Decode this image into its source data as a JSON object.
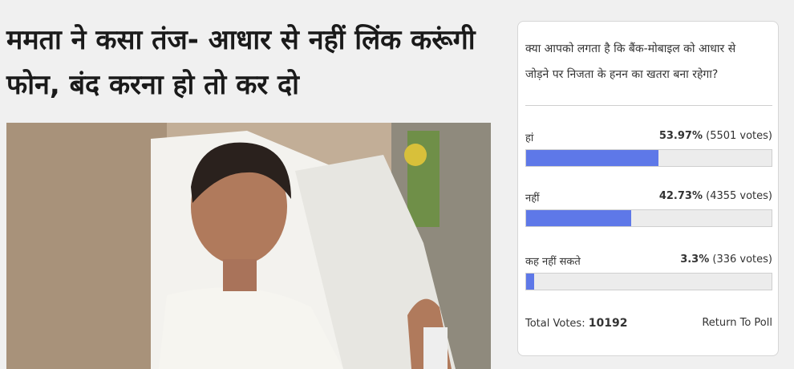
{
  "article": {
    "headline_line1": "ममता ने कसा तंज- आधार से नहीं लिंक करूंगी",
    "headline_line2": "फोन, बंद करना हो तो कर दो"
  },
  "poll": {
    "question_line1": "क्या आपको लगता है कि बैंक-मोबाइल को आधार से",
    "question_line2": "जोड़ने पर निजता के हनन का खतरा बना रहेगा?",
    "options": [
      {
        "label": "हां",
        "percent": "53.97%",
        "votes": "(5501 votes)",
        "fraction": 0.5397
      },
      {
        "label": "नहीं",
        "percent": "42.73%",
        "votes": "(4355 votes)",
        "fraction": 0.4273
      },
      {
        "label": "कह नहीं सकते",
        "percent": "3.3%",
        "votes": "(336 votes)",
        "fraction": 0.033
      }
    ],
    "total_label": "Total Votes:",
    "total_value": "10192",
    "return_label": "Return To Poll",
    "bar_color": "#5e78e8"
  }
}
